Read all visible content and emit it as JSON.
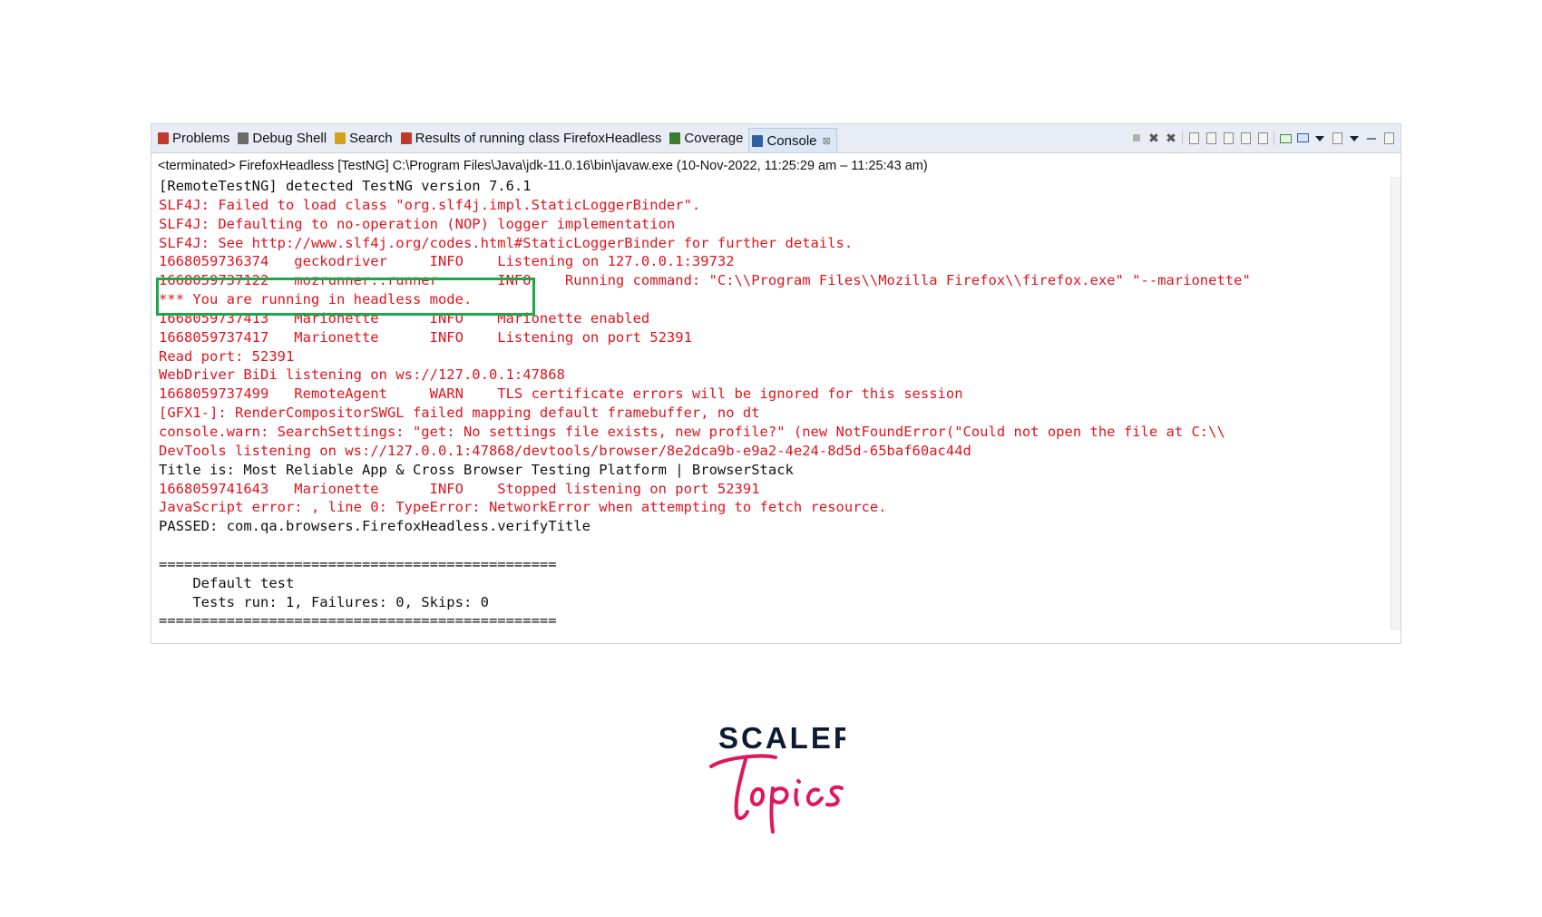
{
  "tabs": [
    {
      "label": "Problems",
      "icon": "problems-icon",
      "color": "#c0392b"
    },
    {
      "label": "Debug Shell",
      "icon": "debug-shell-icon",
      "color": "#6b6b6b"
    },
    {
      "label": "Search",
      "icon": "search-icon",
      "color": "#d6a21a"
    },
    {
      "label": "Results of running class FirefoxHeadless",
      "icon": "testng-results-icon",
      "color": "#c0392b"
    },
    {
      "label": "Coverage",
      "icon": "coverage-icon",
      "color": "#3b7a2f"
    },
    {
      "label": "Console",
      "icon": "console-icon",
      "color": "#2f5f9e",
      "close": "⊠",
      "active": true
    }
  ],
  "status_line": "<terminated> FirefoxHeadless [TestNG] C:\\Program Files\\Java\\jdk-11.0.16\\bin\\javaw.exe  (10-Nov-2022, 11:25:29 am – 11:25:43 am)",
  "console_lines": [
    {
      "text": "[RemoteTestNG] detected TestNG version 7.6.1",
      "color": "black"
    },
    {
      "text": "SLF4J: Failed to load class \"org.slf4j.impl.StaticLoggerBinder\".",
      "color": "red"
    },
    {
      "text": "SLF4J: Defaulting to no-operation (NOP) logger implementation",
      "color": "red"
    },
    {
      "text": "SLF4J: See http://www.slf4j.org/codes.html#StaticLoggerBinder for further details.",
      "color": "red"
    },
    {
      "text": "1668059736374   geckodriver     INFO    Listening on 127.0.0.1:39732",
      "color": "red"
    },
    {
      "text": "1668059737122   mozrunner::runner       INFO    Running command: \"C:\\\\Program Files\\\\Mozilla Firefox\\\\firefox.exe\" \"--marionette\"",
      "color": "red"
    },
    {
      "text": "*** You are running in headless mode.",
      "color": "red"
    },
    {
      "text": "1668059737413   Marionette      INFO    Marionette enabled",
      "color": "red"
    },
    {
      "text": "1668059737417   Marionette      INFO    Listening on port 52391",
      "color": "red"
    },
    {
      "text": "Read port: 52391",
      "color": "red"
    },
    {
      "text": "WebDriver BiDi listening on ws://127.0.0.1:47868",
      "color": "red"
    },
    {
      "text": "1668059737499   RemoteAgent     WARN    TLS certificate errors will be ignored for this session",
      "color": "red"
    },
    {
      "text": "[GFX1-]: RenderCompositorSWGL failed mapping default framebuffer, no dt",
      "color": "red"
    },
    {
      "text": "console.warn: SearchSettings: \"get: No settings file exists, new profile?\" (new NotFoundError(\"Could not open the file at C:\\\\",
      "color": "red"
    },
    {
      "text": "DevTools listening on ws://127.0.0.1:47868/devtools/browser/8e2dca9b-e9a2-4e24-8d5d-65baf60ac44d",
      "color": "red"
    },
    {
      "text": "Title is: Most Reliable App & Cross Browser Testing Platform | BrowserStack",
      "color": "black"
    },
    {
      "text": "1668059741643   Marionette      INFO    Stopped listening on port 52391",
      "color": "red"
    },
    {
      "text": "JavaScript error: , line 0: TypeError: NetworkError when attempting to fetch resource.",
      "color": "red"
    },
    {
      "text": "PASSED: com.qa.browsers.FirefoxHeadless.verifyTitle",
      "color": "black"
    },
    {
      "text": "",
      "color": "black"
    },
    {
      "text": "===============================================",
      "color": "black"
    },
    {
      "text": "    Default test",
      "color": "black"
    },
    {
      "text": "    Tests run: 1, Failures: 0, Skips: 0",
      "color": "black"
    },
    {
      "text": "===============================================",
      "color": "black"
    }
  ],
  "logo": {
    "word": "SCALER",
    "script": "Topics",
    "word_color": "#0c1a33",
    "script_color": "#e0165b"
  },
  "highlight_color": "#1aa84a"
}
